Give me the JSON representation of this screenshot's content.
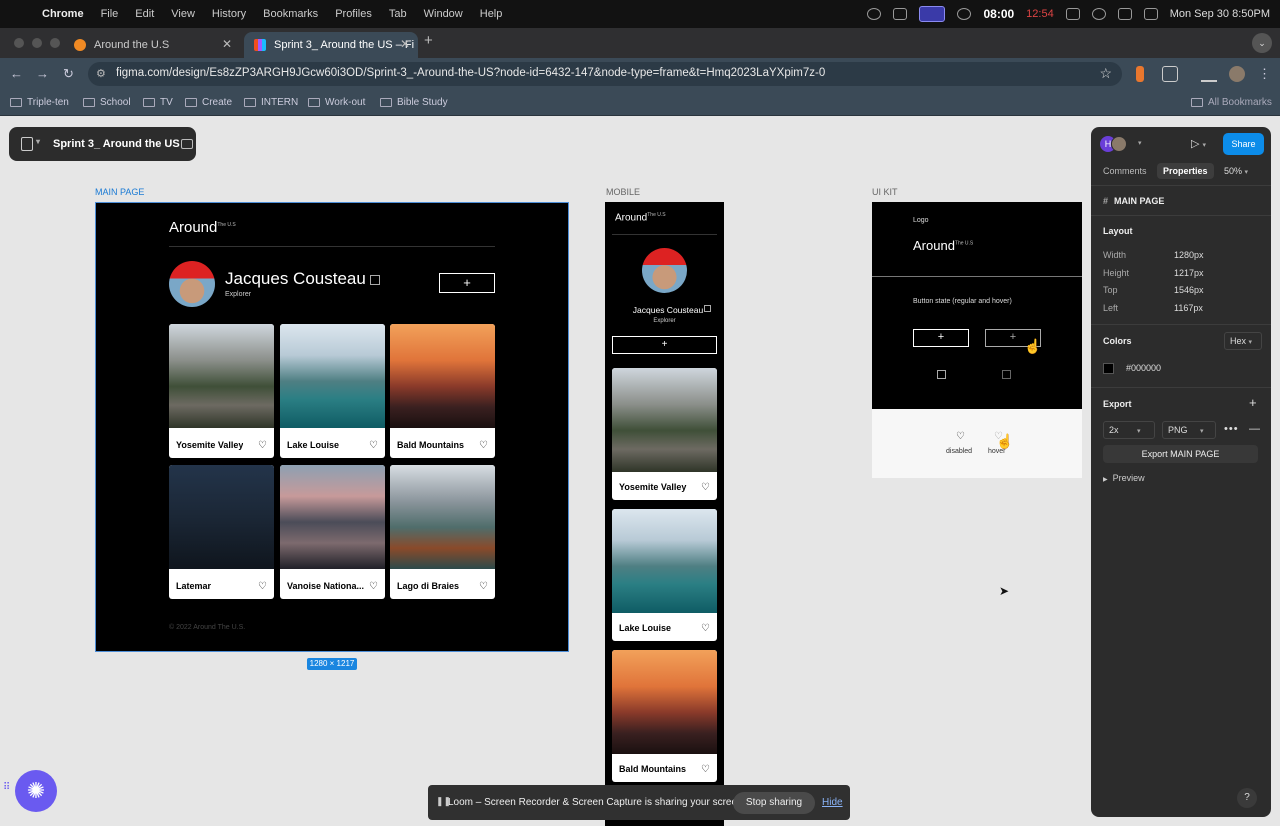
{
  "menubar": {
    "items": [
      "Chrome",
      "File",
      "Edit",
      "View",
      "History",
      "Bookmarks",
      "Profiles",
      "Tab",
      "Window",
      "Help"
    ],
    "timer": "08:00",
    "timer_secondary": "12:54",
    "datetime": "Mon Sep 30  8:50PM"
  },
  "tabs": [
    {
      "title": "Around the U.S",
      "favicon_color": "#f08a24"
    },
    {
      "title": "Sprint 3_ Around the US – Fi",
      "favicon_color": "#a259ff"
    }
  ],
  "omnibox": {
    "url": "figma.com/design/Es8zZP3ARGH9JGcw60i3OD/Sprint-3_-Around-the-US?node-id=6432-147&node-type=frame&t=Hmq2023LaYXpim7z-0"
  },
  "bookmarks": [
    "Triple-ten",
    "School",
    "TV",
    "Create",
    "INTERN",
    "Work-out",
    "Bible Study"
  ],
  "all_bookmarks": "All Bookmarks",
  "figma": {
    "file_name": "Sprint 3_ Around the US",
    "frames": {
      "main": "MAIN PAGE",
      "mobile": "MOBILE",
      "uikit": "UI KIT"
    },
    "dimension_badge": "1280 × 1217"
  },
  "site": {
    "logo": "Around",
    "logo_sup": "The U.S",
    "profile_name": "Jacques Cousteau",
    "profile_job": "Explorer",
    "add_symbol": "+",
    "cards": [
      "Yosemite Valley",
      "Lake Louise",
      "Bald Mountains",
      "Latemar",
      "Vanoise Nationa...",
      "Lago di Braies"
    ],
    "footer": "© 2022 Around The U.S."
  },
  "uikit": {
    "logo_label": "Logo",
    "button_state_label": "Button state (regular and hover)",
    "heart_states": [
      "disabled",
      "hover"
    ]
  },
  "panel": {
    "avatar_initial": "H",
    "share": "Share",
    "tabs": [
      "Comments",
      "Properties"
    ],
    "zoom": "50%",
    "selection": "MAIN PAGE",
    "layout_heading": "Layout",
    "layout": [
      {
        "label": "Width",
        "value": "1280px"
      },
      {
        "label": "Height",
        "value": "1217px"
      },
      {
        "label": "Top",
        "value": "1546px"
      },
      {
        "label": "Left",
        "value": "1167px"
      }
    ],
    "colors_heading": "Colors",
    "color_format": "Hex",
    "color_value": "#000000",
    "export_heading": "Export",
    "export_scale": "2x",
    "export_format": "PNG",
    "export_button": "Export MAIN PAGE",
    "preview": "Preview"
  },
  "loom": {
    "message": "Loom – Screen Recorder & Screen Capture is sharing your screen.",
    "stop": "Stop sharing",
    "hide": "Hide"
  }
}
